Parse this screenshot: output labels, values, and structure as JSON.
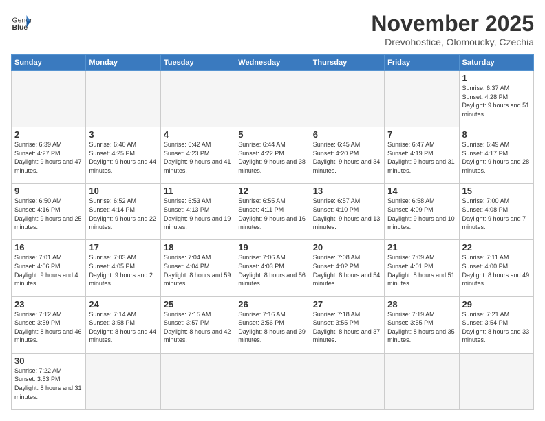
{
  "header": {
    "logo_line1": "General",
    "logo_line2": "Blue",
    "month_title": "November 2025",
    "location": "Drevohostice, Olomoucky, Czechia"
  },
  "days_of_week": [
    "Sunday",
    "Monday",
    "Tuesday",
    "Wednesday",
    "Thursday",
    "Friday",
    "Saturday"
  ],
  "weeks": [
    [
      {
        "num": "",
        "info": ""
      },
      {
        "num": "",
        "info": ""
      },
      {
        "num": "",
        "info": ""
      },
      {
        "num": "",
        "info": ""
      },
      {
        "num": "",
        "info": ""
      },
      {
        "num": "",
        "info": ""
      },
      {
        "num": "1",
        "info": "Sunrise: 6:37 AM\nSunset: 4:28 PM\nDaylight: 9 hours and 51 minutes."
      }
    ],
    [
      {
        "num": "2",
        "info": "Sunrise: 6:39 AM\nSunset: 4:27 PM\nDaylight: 9 hours and 47 minutes."
      },
      {
        "num": "3",
        "info": "Sunrise: 6:40 AM\nSunset: 4:25 PM\nDaylight: 9 hours and 44 minutes."
      },
      {
        "num": "4",
        "info": "Sunrise: 6:42 AM\nSunset: 4:23 PM\nDaylight: 9 hours and 41 minutes."
      },
      {
        "num": "5",
        "info": "Sunrise: 6:44 AM\nSunset: 4:22 PM\nDaylight: 9 hours and 38 minutes."
      },
      {
        "num": "6",
        "info": "Sunrise: 6:45 AM\nSunset: 4:20 PM\nDaylight: 9 hours and 34 minutes."
      },
      {
        "num": "7",
        "info": "Sunrise: 6:47 AM\nSunset: 4:19 PM\nDaylight: 9 hours and 31 minutes."
      },
      {
        "num": "8",
        "info": "Sunrise: 6:49 AM\nSunset: 4:17 PM\nDaylight: 9 hours and 28 minutes."
      }
    ],
    [
      {
        "num": "9",
        "info": "Sunrise: 6:50 AM\nSunset: 4:16 PM\nDaylight: 9 hours and 25 minutes."
      },
      {
        "num": "10",
        "info": "Sunrise: 6:52 AM\nSunset: 4:14 PM\nDaylight: 9 hours and 22 minutes."
      },
      {
        "num": "11",
        "info": "Sunrise: 6:53 AM\nSunset: 4:13 PM\nDaylight: 9 hours and 19 minutes."
      },
      {
        "num": "12",
        "info": "Sunrise: 6:55 AM\nSunset: 4:11 PM\nDaylight: 9 hours and 16 minutes."
      },
      {
        "num": "13",
        "info": "Sunrise: 6:57 AM\nSunset: 4:10 PM\nDaylight: 9 hours and 13 minutes."
      },
      {
        "num": "14",
        "info": "Sunrise: 6:58 AM\nSunset: 4:09 PM\nDaylight: 9 hours and 10 minutes."
      },
      {
        "num": "15",
        "info": "Sunrise: 7:00 AM\nSunset: 4:08 PM\nDaylight: 9 hours and 7 minutes."
      }
    ],
    [
      {
        "num": "16",
        "info": "Sunrise: 7:01 AM\nSunset: 4:06 PM\nDaylight: 9 hours and 4 minutes."
      },
      {
        "num": "17",
        "info": "Sunrise: 7:03 AM\nSunset: 4:05 PM\nDaylight: 9 hours and 2 minutes."
      },
      {
        "num": "18",
        "info": "Sunrise: 7:04 AM\nSunset: 4:04 PM\nDaylight: 8 hours and 59 minutes."
      },
      {
        "num": "19",
        "info": "Sunrise: 7:06 AM\nSunset: 4:03 PM\nDaylight: 8 hours and 56 minutes."
      },
      {
        "num": "20",
        "info": "Sunrise: 7:08 AM\nSunset: 4:02 PM\nDaylight: 8 hours and 54 minutes."
      },
      {
        "num": "21",
        "info": "Sunrise: 7:09 AM\nSunset: 4:01 PM\nDaylight: 8 hours and 51 minutes."
      },
      {
        "num": "22",
        "info": "Sunrise: 7:11 AM\nSunset: 4:00 PM\nDaylight: 8 hours and 49 minutes."
      }
    ],
    [
      {
        "num": "23",
        "info": "Sunrise: 7:12 AM\nSunset: 3:59 PM\nDaylight: 8 hours and 46 minutes."
      },
      {
        "num": "24",
        "info": "Sunrise: 7:14 AM\nSunset: 3:58 PM\nDaylight: 8 hours and 44 minutes."
      },
      {
        "num": "25",
        "info": "Sunrise: 7:15 AM\nSunset: 3:57 PM\nDaylight: 8 hours and 42 minutes."
      },
      {
        "num": "26",
        "info": "Sunrise: 7:16 AM\nSunset: 3:56 PM\nDaylight: 8 hours and 39 minutes."
      },
      {
        "num": "27",
        "info": "Sunrise: 7:18 AM\nSunset: 3:55 PM\nDaylight: 8 hours and 37 minutes."
      },
      {
        "num": "28",
        "info": "Sunrise: 7:19 AM\nSunset: 3:55 PM\nDaylight: 8 hours and 35 minutes."
      },
      {
        "num": "29",
        "info": "Sunrise: 7:21 AM\nSunset: 3:54 PM\nDaylight: 8 hours and 33 minutes."
      }
    ],
    [
      {
        "num": "30",
        "info": "Sunrise: 7:22 AM\nSunset: 3:53 PM\nDaylight: 8 hours and 31 minutes."
      },
      {
        "num": "",
        "info": ""
      },
      {
        "num": "",
        "info": ""
      },
      {
        "num": "",
        "info": ""
      },
      {
        "num": "",
        "info": ""
      },
      {
        "num": "",
        "info": ""
      },
      {
        "num": "",
        "info": ""
      }
    ]
  ]
}
